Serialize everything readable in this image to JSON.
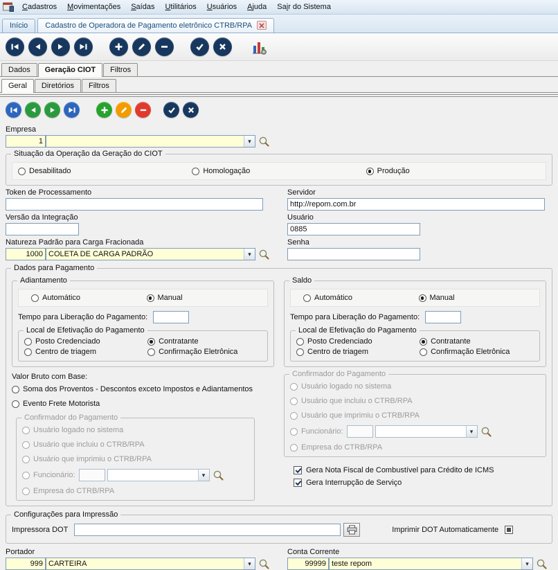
{
  "menu": {
    "items": [
      {
        "pre": "",
        "accel": "C",
        "post": "adastros"
      },
      {
        "pre": "",
        "accel": "M",
        "post": "ovimentações"
      },
      {
        "pre": "",
        "accel": "S",
        "post": "aídas"
      },
      {
        "pre": "",
        "accel": "U",
        "post": "tilitários"
      },
      {
        "pre": "",
        "accel": "U",
        "post": "suários"
      },
      {
        "pre": "",
        "accel": "A",
        "post": "juda"
      },
      {
        "pre": "Sa",
        "accel": "i",
        "post": "r do Sistema"
      }
    ]
  },
  "window_tabs": {
    "home": "Início",
    "active": "Cadastro de Operadora de Pagamento eletrônico CTRB/RPA"
  },
  "main_tabs": {
    "dados": "Dados",
    "geracao": "Geração CIOT",
    "filtros": "Filtros"
  },
  "sub_tabs": {
    "geral": "Geral",
    "diretorios": "Diretórios",
    "filtros": "Filtros"
  },
  "fields": {
    "empresa_label": "Empresa",
    "empresa_code": "1",
    "empresa_name": "",
    "situacao_title": "Situação da Operação da Geração do CIOT",
    "situacao_options": [
      "Desabilitado",
      "Homologação",
      "Produção"
    ],
    "token_label": "Token de Processamento",
    "token_value": "",
    "servidor_label": "Servidor",
    "servidor_value": "http://repom.com.br",
    "versao_label": "Versão da Integração",
    "versao_value": "",
    "usuario_label": "Usuário",
    "usuario_value": "0885",
    "natureza_label": "Natureza Padrão para Carga Fracionada",
    "natureza_code": "1000",
    "natureza_name": "COLETA DE CARGA PADRÃO",
    "senha_label": "Senha",
    "senha_value": ""
  },
  "payment": {
    "title": "Dados para Pagamento",
    "adiantamento_title": "Adiantamento",
    "saldo_title": "Saldo",
    "auto": "Automático",
    "manual": "Manual",
    "tempo_label": "Tempo para Liberação do Pagamento:",
    "tempo_adiantamento": "",
    "tempo_saldo": "",
    "local_title": "Local de Efetivação do Pagamento",
    "local_options": [
      "Posto Credenciado",
      "Contratante",
      "Centro de triagem",
      "Confirmação Eletrônica"
    ],
    "valor_bruto_label": "Valor Bruto com Base:",
    "valor_bruto_options": [
      "Soma dos Proventos - Descontos exceto Impostos e Adiantamentos",
      "Evento Frete Motorista"
    ],
    "confirmador_title": "Confirmador do Pagamento",
    "confirmador_options": [
      "Usuário logado no sistema",
      "Usuário que incluiu o CTRB/RPA",
      "Usuário que imprimiu o CTRB/RPA",
      "Funcionário:",
      "Empresa do CTRB/RPA"
    ],
    "funcionario_code": "",
    "funcionario_name": "",
    "checkboxes": [
      "Gera Nota Fiscal de Combustível para Crédito de ICMS",
      "Gera Interrupção de Serviço"
    ]
  },
  "impressao": {
    "title": "Configurações para Impressão",
    "impressora_label": "Impressora DOT",
    "impressora_value": "",
    "auto_label": "Imprimir DOT Automaticamente"
  },
  "portador": {
    "label": "Portador",
    "code": "999",
    "name": "CARTEIRA"
  },
  "conta": {
    "label": "Conta Corrente",
    "code": "99999",
    "name": "teste repom"
  },
  "states": {
    "situacao_selected": "Produção",
    "adiantamento_mode": "Manual",
    "adiantamento_local": "Contratante",
    "saldo_mode": "Manual",
    "saldo_local": "Contratante",
    "gera_nota_fiscal": true,
    "gera_interrupcao": true,
    "imprimir_dot_auto": true
  },
  "colors": {
    "accent": "#17375e",
    "input_highlight": "#ffffd7"
  }
}
